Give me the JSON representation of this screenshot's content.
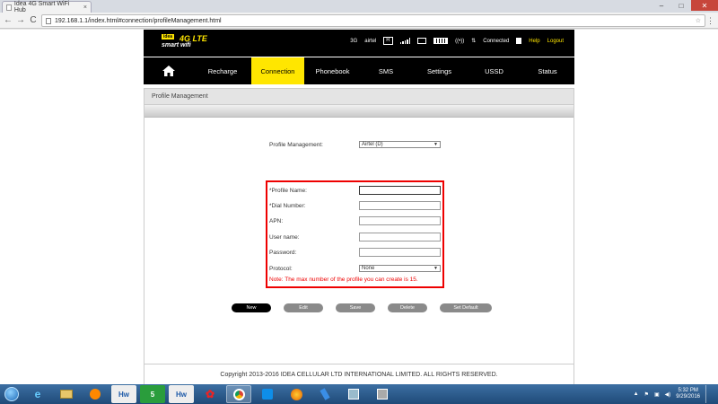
{
  "browser": {
    "tab_title": "Idea 4G Smart WiFi Hub",
    "tab_close": "×",
    "url": "192.168.1.1/index.html#connection/profileManagement.html",
    "back_glyph": "←",
    "forward_glyph": "→",
    "reload_glyph": "C",
    "window_controls": {
      "minimize": "–",
      "maximize": "□",
      "close": "✕"
    }
  },
  "header": {
    "logo_brand": "idea",
    "logo_4g": "4G LTE",
    "logo_smart": "smart wifi",
    "network_type": "3G",
    "operator": "airtel",
    "roaming_indicator": "R",
    "connection_status": "Connected",
    "help_label": "Help",
    "logout_label": "Logout"
  },
  "nav": {
    "items": [
      {
        "label": "Recharge"
      },
      {
        "label": "Connection"
      },
      {
        "label": "Phonebook"
      },
      {
        "label": "SMS"
      },
      {
        "label": "Settings"
      },
      {
        "label": "USSD"
      },
      {
        "label": "Status"
      }
    ],
    "active": "Connection"
  },
  "panel": {
    "title": "Profile Management"
  },
  "form": {
    "profile_management_label": "Profile Management:",
    "profile_management_value": "Airtel (D)",
    "profile_name_label": "*Profile Name:",
    "profile_name_value": "",
    "dial_number_label": "*Dial Number:",
    "dial_number_value": "",
    "apn_label": "APN:",
    "apn_value": "",
    "username_label": "User name:",
    "username_value": "",
    "password_label": "Password:",
    "password_value": "",
    "protocol_label": "Protocol:",
    "protocol_value": "None",
    "note": "Note: The max number of the profile you can create is 15."
  },
  "buttons": {
    "new": "New",
    "edit": "Edit",
    "save": "Save",
    "delete": "Delete",
    "set_default": "Set Default"
  },
  "footer": {
    "copyright": "Copyright 2013-2016 IDEA CELLULAR LTD INTERNATIONAL LIMITED. ALL RIGHTS RESERVED."
  },
  "taskbar": {
    "items": [
      "Hw",
      "5",
      "Hw"
    ],
    "time": "5:32 PM",
    "date": "9/29/2016"
  },
  "colors": {
    "brand_yellow": "#ffe600",
    "highlight_red": "#ee0000"
  }
}
